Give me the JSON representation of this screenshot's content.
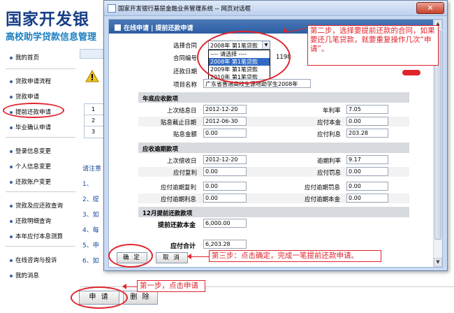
{
  "app": {
    "title": "国家开发银",
    "subtitle": "高校助学贷款信息管理"
  },
  "sidebar": {
    "items": [
      {
        "label": "我的首页"
      },
      {
        "label": "贷款申请流程"
      },
      {
        "label": "贷款申请"
      },
      {
        "label": "提前还款申请"
      },
      {
        "label": "毕业确认申请"
      },
      {
        "label": "登录信息变更"
      },
      {
        "label": "个人信息变更"
      },
      {
        "label": "还款账户变更"
      },
      {
        "label": "贷款及应还款查询"
      },
      {
        "label": "还款明细查询"
      },
      {
        "label": "本年应付本息测算"
      },
      {
        "label": "在线咨询与投诉"
      },
      {
        "label": "我的消息"
      }
    ]
  },
  "background": {
    "grid_rows": [
      "1",
      "2",
      "3"
    ],
    "notes": {
      "intro": "请注意",
      "items": [
        "1、",
        "2、提",
        "3、如",
        "4、每",
        "5、申",
        "6、如"
      ]
    },
    "apply_button": "申 请",
    "delete_button": "删 除"
  },
  "dialog": {
    "title": "国家开发银行基层金融业务管理系统 -- 网页对话框",
    "close_glyph": "✕",
    "header": "在线申请 | 提前还款申请",
    "contract_select": {
      "label": "选择合同",
      "value": "2008年 第1笔贷款",
      "options": [
        "---- 请选择 ----",
        "2008年 第1笔贷款",
        "2009年 第1笔贷款",
        "2010年 第1笔贷款"
      ],
      "selected_index": 1
    },
    "contract_number": {
      "label": "合同编号",
      "value": "1198"
    },
    "repay_date": {
      "label": "还款日期"
    },
    "project_name": {
      "label": "项目名称",
      "value": "广东省普通高校生源地助学生2008年"
    },
    "year_end_section": {
      "title": "年底应收款项",
      "last_settle_date": {
        "label": "上次结息日",
        "value": "2012-12-20"
      },
      "annual_rate": {
        "label": "年利率",
        "value": "7.05"
      },
      "subsidy_end_date": {
        "label": "贴息截止日期",
        "value": "2012-06-30"
      },
      "payable_principal": {
        "label": "应付本金",
        "value": "0.00"
      },
      "subsidy_amount": {
        "label": "贴息金额",
        "value": "0.00"
      },
      "payable_interest": {
        "label": "应付利息",
        "value": "203.28"
      }
    },
    "overdue_section": {
      "title": "应收逾期款项",
      "last_repay_date": {
        "label": "上次偿收日",
        "value": "2012-12-20"
      },
      "overdue_rate": {
        "label": "逾期利率",
        "value": "9.17"
      },
      "compound_interest": {
        "label": "应付复利",
        "value": "0.00"
      },
      "penalty_interest": {
        "label": "应付罚息",
        "value": "0.00"
      },
      "overdue_compound": {
        "label": "应付逾期复利",
        "value": "0.00"
      },
      "overdue_penalty": {
        "label": "应付逾期罚息",
        "value": "0.00"
      },
      "overdue_interest": {
        "label": "应付逾期利息",
        "value": "0.00"
      },
      "overdue_principal": {
        "label": "应付逾期本金",
        "value": "0.00"
      }
    },
    "prepay_section": {
      "title": "12月提前还款款项",
      "prepay_principal": {
        "label": "提前还款本金",
        "value": "6,000.00"
      },
      "total_payable": {
        "label": "应付合计",
        "value": "6,203.28"
      }
    },
    "ok_button": "确 定",
    "cancel_button": "取 消"
  },
  "annotations": {
    "step1": "第一步，点击申请",
    "step2": "第二步，选择要提前还款的合同，如果要还几笔贷款，就要重复操作几次“申请”。",
    "step3": "第三步：点击确定，完成一笔提前还款申请。"
  },
  "colors": {
    "annotation": "#e0242c",
    "header_blue": "#2c5ea4",
    "title_blue": "#163e86"
  },
  "icons": {
    "alert": "warning-icon",
    "dialog_app": "ie-icon",
    "close": "close-icon"
  }
}
